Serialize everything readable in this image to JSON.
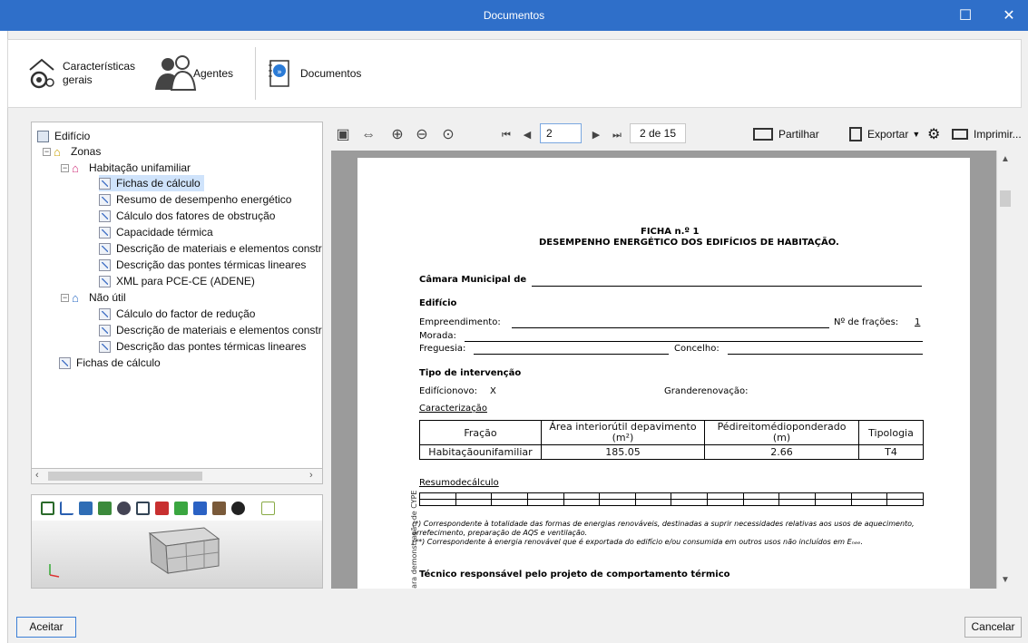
{
  "window": {
    "title": "Documentos",
    "maximize_glyph": "☐",
    "close_glyph": "✕"
  },
  "toolbar": {
    "items": [
      {
        "label_line1": "Características",
        "label_line2": "gerais",
        "icon": "gear-house-icon"
      },
      {
        "label": "Agentes",
        "icon": "people-icon"
      },
      {
        "label": "Documentos",
        "icon": "documents-icon"
      }
    ]
  },
  "tree": {
    "root": "Edifício",
    "zonas": "Zonas",
    "hab": "Habitação unifamiliar",
    "hab_items": [
      "Fichas de cálculo",
      "Resumo de desempenho energético",
      "Cálculo dos fatores de obstrução",
      "Capacidade térmica",
      "Descrição de materiais e elementos constru",
      "Descrição das pontes térmicas lineares",
      "XML para PCE-CE (ADENE)"
    ],
    "nao_util": "Não útil",
    "nao_items": [
      "Cálculo do factor de redução",
      "Descrição de materiais e elementos constru",
      "Descrição das pontes térmicas lineares"
    ],
    "fichas": "Fichas de cálculo"
  },
  "viewer": {
    "tools": [
      "layers-icon",
      "axes-icon",
      "box-icon",
      "group-icon",
      "eye-icon",
      "split-icon",
      "red-icon",
      "green-icon",
      "blue-icon",
      "cube-icon",
      "hide-icon",
      "3d-icon"
    ]
  },
  "pager": {
    "current_page": "2",
    "page_count": "2 de 15",
    "share": "Partilhar",
    "export": "Exportar",
    "print": "Imprimir..."
  },
  "document": {
    "ficha_title": "FICHA n.º 1",
    "ficha_subtitle": "DESEMPENHO ENERGÉTICO DOS EDIFÍCIOS DE HABITAÇÃO.",
    "camara": "Câmara Municipal de",
    "edificio_heading": "Edifício",
    "empreendimento": "Empreendimento:",
    "n_fracoes_label": "Nº de frações:",
    "n_fracoes": "1",
    "morada": "Morada:",
    "freguesia": "Freguesia:",
    "concelho": "Concelho:",
    "intervencao_heading": "Tipo de intervenção",
    "edificio_novo": "Edifícionovo:",
    "edificio_novo_mark": "X",
    "grande_renovacao": "Grandere­novação:",
    "caracterizacao": "Caracterização",
    "table_headers": [
      "Fração",
      "Área interiorútil depavimento (m²)",
      "Pédireitomédioponderado (m)",
      "Tipologia"
    ],
    "table_row": [
      "Habitaçãounifamiliar",
      "185.05",
      "2.66",
      "T4"
    ],
    "resumo": "Resumodecálculo",
    "note1": "(*) Correspondente à totalidade das formas de energias renováveis, destinadas a suprir necessidades relativas aos usos de aquecimento,",
    "note1b": "arrefecimento, preparação de AQS e ventilação.",
    "note2": "(**) Correspondente à energia renovável que é exportada do edifício e/ou consumida em outros usos não incluídos em Eₙₑₑ.",
    "tecnico": "Técnico responsável pelo projeto de comportamento térmico",
    "side_text": "para demonstração de CYPE"
  },
  "buttons": {
    "accept": "Aceitar",
    "cancel": "Cancelar"
  }
}
